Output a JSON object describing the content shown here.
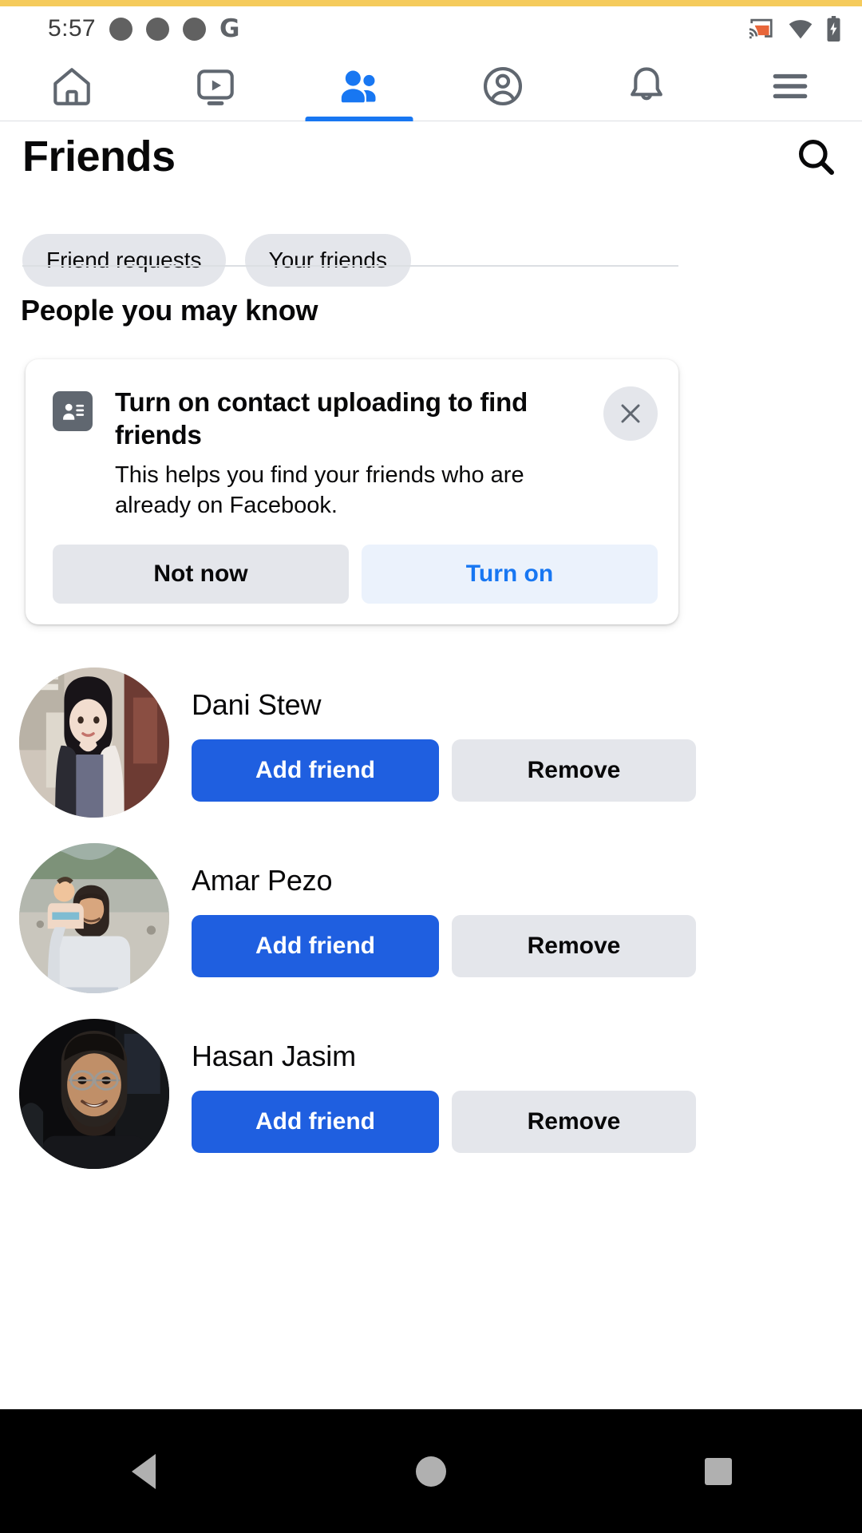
{
  "status_bar": {
    "time": "5:57",
    "left_icons": [
      "dot-icon",
      "dot-icon",
      "dot-icon",
      "google-g-icon"
    ],
    "right_icons": [
      "cast-icon",
      "wifi-icon",
      "battery-charging-icon"
    ],
    "cast_color": "#e8663a"
  },
  "nav_tabs": {
    "active_index": 2,
    "active_color": "#1877f2",
    "inactive_color": "#606770",
    "items": [
      {
        "name": "home-icon",
        "label": "Home"
      },
      {
        "name": "video-icon",
        "label": "Video"
      },
      {
        "name": "friends-icon",
        "label": "Friends"
      },
      {
        "name": "profile-icon",
        "label": "Profile"
      },
      {
        "name": "notifications-bell-icon",
        "label": "Notifications"
      },
      {
        "name": "menu-hamburger-icon",
        "label": "Menu"
      }
    ]
  },
  "header": {
    "title": "Friends",
    "search_icon": "search-icon"
  },
  "chips": [
    {
      "label": "Friend requests"
    },
    {
      "label": "Your friends"
    }
  ],
  "section": {
    "title": "People you may know"
  },
  "contact_card": {
    "icon": "contact-card-icon",
    "title": "Turn on contact uploading to find friends",
    "description": "This helps you find your friends who are already on Facebook.",
    "close_icon": "close-icon",
    "buttons": {
      "secondary": "Not now",
      "primary": "Turn on"
    },
    "primary_color": "#1877f2"
  },
  "people": [
    {
      "name": "Dani Stew",
      "avatar": "photo-woman-dark-hair",
      "add_label": "Add friend",
      "remove_label": "Remove"
    },
    {
      "name": "Amar Pezo",
      "avatar": "photo-man-holding-child-outdoors",
      "add_label": "Add friend",
      "remove_label": "Remove"
    },
    {
      "name": "Hasan Jasim",
      "avatar": "photo-man-glasses-beard",
      "add_label": "Add friend",
      "remove_label": "Remove"
    }
  ],
  "colors": {
    "add_friend_blue": "#1f5fe0",
    "chip_gray": "#e4e6eb",
    "text_primary": "#080809"
  },
  "system_nav": {
    "back": "back-triangle-icon",
    "home": "home-circle-icon",
    "recents": "recents-square-icon"
  }
}
